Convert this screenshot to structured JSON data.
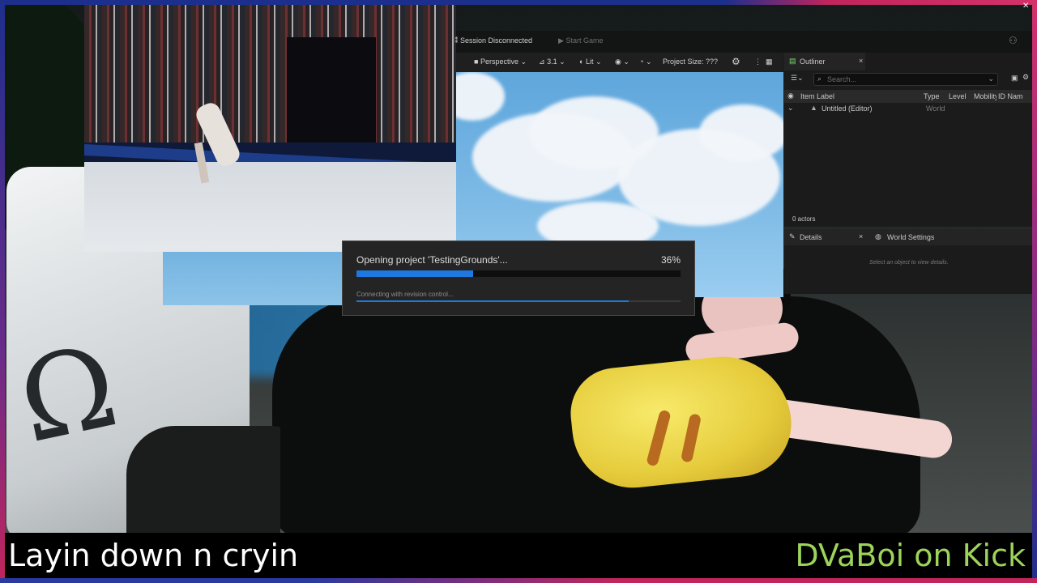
{
  "stream": {
    "caption_left": "Layin down n cryin",
    "caption_right": "DVaBoi on Kick",
    "caption_right_color": "#9cd35a"
  },
  "editor": {
    "topbar": {
      "session_label": "Session Disconnected",
      "start_game_label": "Start Game"
    },
    "viewport_toolbar": {
      "perspective_label": "Perspective",
      "speed_label": "3.1",
      "lit_label": "Lit",
      "project_size_label": "Project Size: ???"
    },
    "outliner": {
      "tab_label": "Outliner",
      "search_placeholder": "Search...",
      "columns": [
        "Item Label",
        "Type",
        "Level",
        "Mobility",
        "ID Name"
      ],
      "rows": [
        {
          "label": "Untitled (Editor)",
          "type": "World"
        }
      ],
      "footer": "0 actors"
    },
    "details": {
      "tab_label": "Details",
      "world_settings_label": "World Settings",
      "empty_message": "Select an object to view details."
    }
  },
  "progress_dialog": {
    "title": "Opening project 'TestingGrounds'...",
    "percent_label": "36%",
    "progress": 0.36,
    "sub_status": "Connecting with revision control...",
    "sub_progress": 0.84
  }
}
